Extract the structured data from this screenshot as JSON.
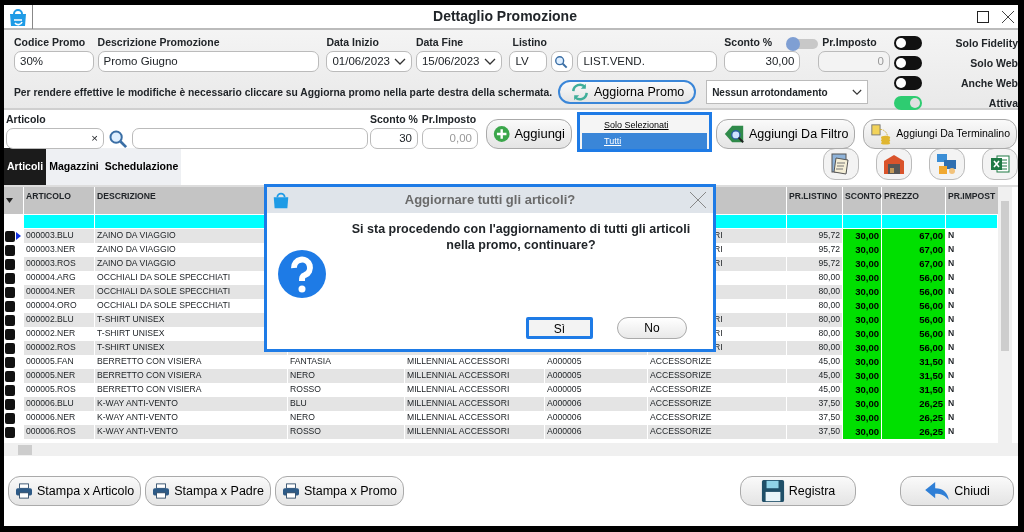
{
  "window": {
    "title": "Dettaglio Promozione"
  },
  "codice_promo": {
    "label": "Codice Promo",
    "value": "30%"
  },
  "descrizione": {
    "label": "Descrizione Promozione",
    "value": "Promo Giugno"
  },
  "data_inizio": {
    "label": "Data Inizio",
    "value": "01/06/2023"
  },
  "data_fine": {
    "label": "Data Fine",
    "value": "15/06/2023"
  },
  "listino": {
    "label": "Listino",
    "code": "LV",
    "name": "LIST.VEND."
  },
  "sconto": {
    "label": "Sconto %",
    "value": "30,00",
    "toggle_on": false
  },
  "pr_imposto": {
    "label": "Pr.Imposto",
    "value": "0",
    "disabled": true
  },
  "flags": [
    {
      "label": "Solo Fidelity",
      "on": false
    },
    {
      "label": "Solo Web",
      "on": false
    },
    {
      "label": "Anche Web",
      "on": false
    },
    {
      "label": "Attiva",
      "on": true
    }
  ],
  "notice": "Per rendere effettive le modifiche è necessario cliccare su Aggiorna promo nella parte destra della schermata.",
  "aggiorna_button": "Aggiorna Promo",
  "arrotondamento": "Nessun arrotondamento",
  "articolo_bar": {
    "label": "Articolo",
    "clear": "×",
    "sconto_label": "Sconto %",
    "pr_imposto_label": "Pr.Imposto",
    "sconto_value": "30",
    "pr_imposto_value": "0,00"
  },
  "aggiungi_button": "Aggiungi",
  "aggiungi_menu": [
    {
      "label": "Solo Selezionati",
      "selected": false
    },
    {
      "label": "Tutti",
      "selected": true
    }
  ],
  "extra_buttons": [
    {
      "label": "Aggiungi Da Filtro",
      "kind": "filter"
    },
    {
      "label": "Aggiungi Da Terminalino",
      "kind": "terminal"
    }
  ],
  "tabs": [
    {
      "label": "Articoli",
      "selected": true
    },
    {
      "label": "Magazzini",
      "selected": false
    },
    {
      "label": "Schedulazione",
      "selected": false
    }
  ],
  "table": {
    "columns": [
      "ARTICOLO",
      "DESCRIZIONE",
      "PR.LISTINO",
      "SCONTO",
      "PREZZO",
      "PR.IMPOST"
    ],
    "rows": [
      {
        "selected": true,
        "covered": true,
        "fragment": "RI",
        "cells": [
          "000003.BLU",
          "ZAINO DA VIAGGIO",
          "95,72",
          "30,00",
          "67,00",
          "N"
        ]
      },
      {
        "selected": false,
        "covered": true,
        "fragment": "RI",
        "cells": [
          "000003.NER",
          "ZAINO DA VIAGGIO",
          "95,72",
          "30,00",
          "67,00",
          "N"
        ]
      },
      {
        "selected": false,
        "covered": true,
        "fragment": "RI",
        "cells": [
          "000003.ROS",
          "ZAINO DA VIAGGIO",
          "95,72",
          "30,00",
          "67,00",
          "N"
        ]
      },
      {
        "selected": false,
        "covered": true,
        "cells": [
          "000004.ARG",
          "OCCHIALI DA SOLE SPECCHIATI",
          "80,00",
          "30,00",
          "56,00",
          "N"
        ]
      },
      {
        "selected": false,
        "covered": true,
        "cells": [
          "000004.NER",
          "OCCHIALI DA SOLE SPECCHIATI",
          "80,00",
          "30,00",
          "56,00",
          "N"
        ]
      },
      {
        "selected": false,
        "covered": true,
        "cells": [
          "000004.ORO",
          "OCCHIALI DA SOLE SPECCHIATI",
          "80,00",
          "30,00",
          "56,00",
          "N"
        ]
      },
      {
        "selected": false,
        "covered": true,
        "fragment": "RI",
        "cells": [
          "000002.BLU",
          "T-SHIRT UNISEX",
          "80,00",
          "30,00",
          "56,00",
          "N"
        ]
      },
      {
        "selected": false,
        "covered": true,
        "fragment": "RI",
        "cells": [
          "000002.NER",
          "T-SHIRT UNISEX",
          "80,00",
          "30,00",
          "56,00",
          "N"
        ]
      },
      {
        "selected": false,
        "covered": true,
        "fragment": "RI",
        "cells": [
          "000002.ROS",
          "T-SHIRT UNISEX",
          "80,00",
          "30,00",
          "56,00",
          "N"
        ]
      },
      {
        "selected": false,
        "covered": false,
        "cells": [
          "000005.FAN",
          "BERRETTO CON VISIERA",
          "FANTASIA",
          "MILLENNIAL ACCESSORI",
          "A000005",
          "ACCESSORIZE",
          "45,00",
          "30,00",
          "31,50",
          "N"
        ]
      },
      {
        "selected": false,
        "covered": false,
        "cells": [
          "000005.NER",
          "BERRETTO CON VISIERA",
          "NERO",
          "MILLENNIAL ACCESSORI",
          "A000005",
          "ACCESSORIZE",
          "45,00",
          "30,00",
          "31,50",
          "N"
        ]
      },
      {
        "selected": false,
        "covered": false,
        "cells": [
          "000005.ROS",
          "BERRETTO CON VISIERA",
          "ROSSO",
          "MILLENNIAL ACCESSORI",
          "A000005",
          "ACCESSORIZE",
          "45,00",
          "30,00",
          "31,50",
          "N"
        ]
      },
      {
        "selected": false,
        "covered": false,
        "cells": [
          "000006.BLU",
          "K-WAY ANTI-VENTO",
          "BLU",
          "MILLENNIAL ACCESSORI",
          "A000006",
          "ACCESSORIZE",
          "37,50",
          "30,00",
          "26,25",
          "N"
        ]
      },
      {
        "selected": false,
        "covered": false,
        "cells": [
          "000006.NER",
          "K-WAY ANTI-VENTO",
          "NERO",
          "MILLENNIAL ACCESSORI",
          "A000006",
          "ACCESSORIZE",
          "37,50",
          "30,00",
          "26,25",
          "N"
        ]
      },
      {
        "selected": false,
        "covered": false,
        "cells": [
          "000006.ROS",
          "K-WAY ANTI-VENTO",
          "ROSSO",
          "MILLENNIAL ACCESSORI",
          "A000006",
          "ACCESSORIZE",
          "37,50",
          "30,00",
          "26,25",
          "N"
        ]
      }
    ]
  },
  "dialog": {
    "title": "Aggiornare tutti gli articoli?",
    "message": "Si sta procedendo con l'aggiornamento di tutti gli articoli nella promo, continuare?",
    "buttons": [
      {
        "label": "Sì",
        "focused": true
      },
      {
        "label": "No",
        "focused": false
      }
    ]
  },
  "print_buttons": [
    "Stampa x Articolo",
    "Stampa x Padre",
    "Stampa x Promo"
  ],
  "action_buttons": [
    {
      "label": "Registra",
      "kind": "save"
    },
    {
      "label": "Chiudi",
      "kind": "back"
    }
  ]
}
